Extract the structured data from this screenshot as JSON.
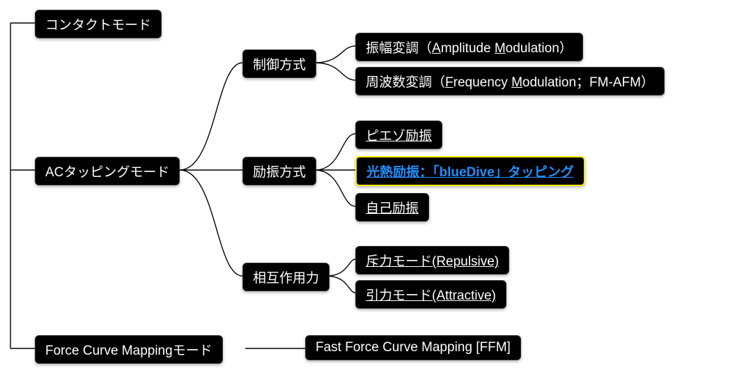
{
  "nodes": {
    "contact": "コンタクトモード",
    "ac_tapping": "ACタッピングモード",
    "force_curve": "Force Curve Mappingモード",
    "control_method": "制御方式",
    "excitation_method": "励振方式",
    "interaction_force": "相互作用力",
    "amplitude_modulation_pre": "振幅変調（",
    "amplitude_modulation_a": "A",
    "amplitude_modulation_mid": "mplitude ",
    "amplitude_modulation_m": "M",
    "amplitude_modulation_post": "odulation）",
    "frequency_modulation_pre": "周波数変調（",
    "frequency_modulation_f": "F",
    "frequency_modulation_mid": "requency ",
    "frequency_modulation_m": "M",
    "frequency_modulation_post": "odulation；FM-AFM）",
    "piezo": "ピエゾ励振",
    "bluedive": "光熱励振：「blueDive」タッピング",
    "self_excitation": "自己励振",
    "repulsive": "斥力モード(Repulsive)",
    "attractive": "引力モード(Attractive)",
    "ffm": "Fast Force Curve Mapping [FFM]"
  }
}
